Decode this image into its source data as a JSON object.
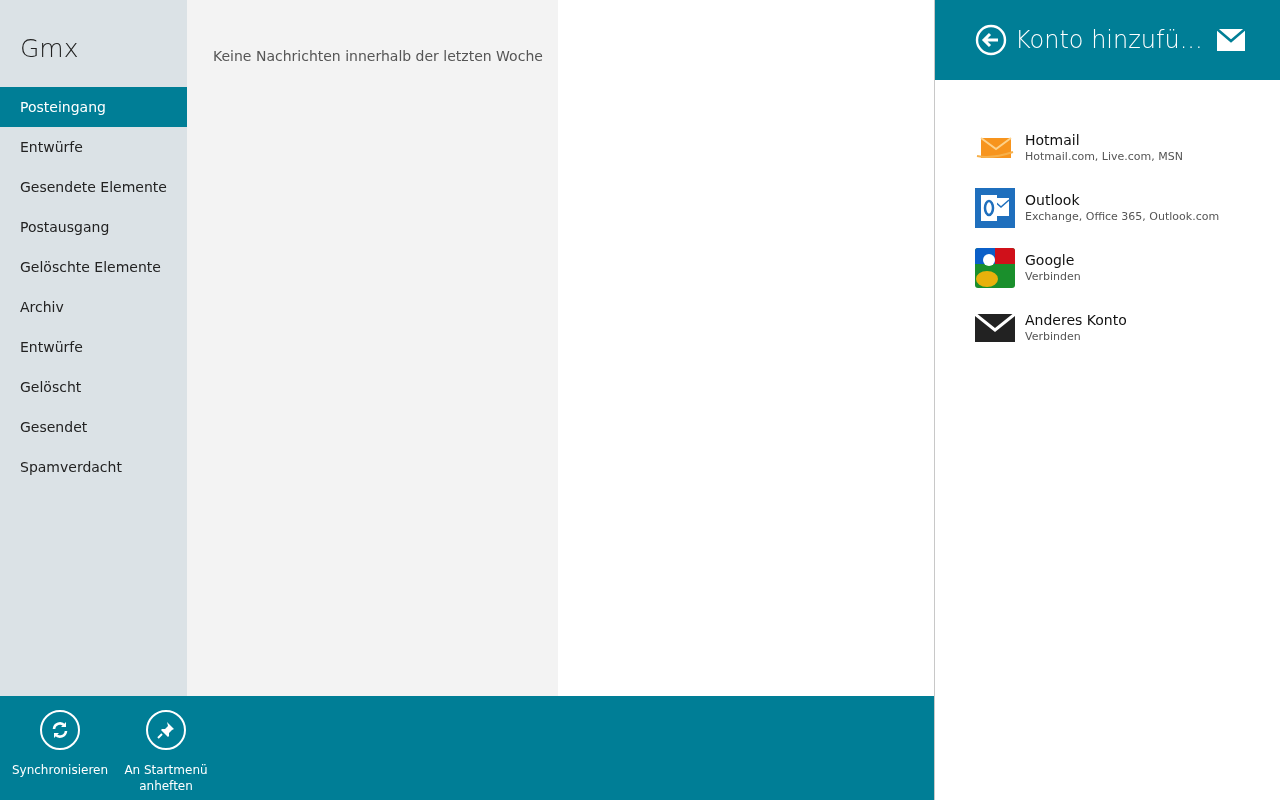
{
  "account_title": "Gmx",
  "folders": [
    {
      "label": "Posteingang",
      "selected": true
    },
    {
      "label": "Entwürfe",
      "selected": false
    },
    {
      "label": "Gesendete Elemente",
      "selected": false
    },
    {
      "label": "Postausgang",
      "selected": false
    },
    {
      "label": "Gelöschte Elemente",
      "selected": false
    },
    {
      "label": "Archiv",
      "selected": false
    },
    {
      "label": "Entwürfe",
      "selected": false
    },
    {
      "label": "Gelöscht",
      "selected": false
    },
    {
      "label": "Gesendet",
      "selected": false
    },
    {
      "label": "Spamverdacht",
      "selected": false
    }
  ],
  "message_list": {
    "empty_text": "Keine Nachrichten innerhalb der letzten Woche"
  },
  "app_bar": [
    {
      "kind": "sync",
      "label": "Synchronisieren"
    },
    {
      "kind": "pin",
      "label": "An Startmenü anheften"
    }
  ],
  "flyout": {
    "title": "Konto hinzufü...",
    "accounts": [
      {
        "kind": "hotmail",
        "name": "Hotmail",
        "detail": "Hotmail.com, Live.com, MSN"
      },
      {
        "kind": "outlook",
        "name": "Outlook",
        "detail": "Exchange, Office 365, Outlook.com"
      },
      {
        "kind": "google",
        "name": "Google",
        "detail": "Verbinden"
      },
      {
        "kind": "other",
        "name": "Anderes Konto",
        "detail": "Verbinden"
      }
    ]
  }
}
